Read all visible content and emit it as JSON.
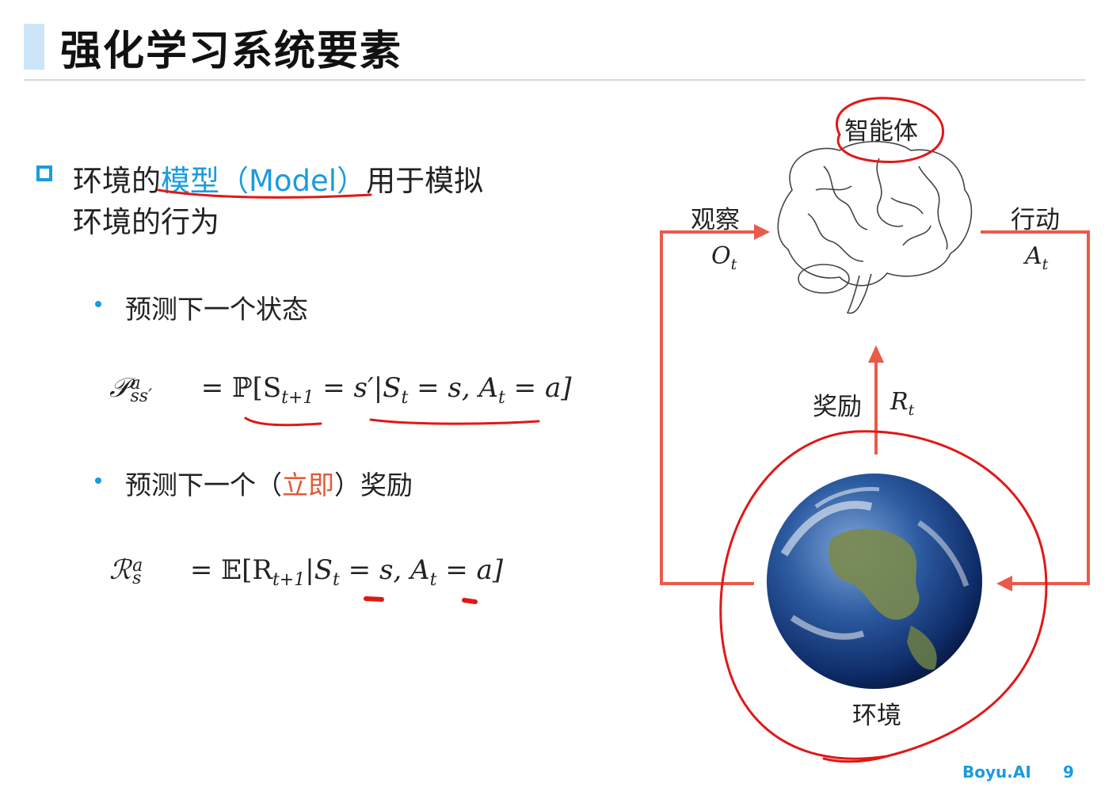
{
  "title": "强化学习系统要素",
  "main": {
    "line1_prefix": "环境的",
    "line1_highlight": "模型（Model）",
    "line1_suffix": "用于模拟",
    "line2": "环境的行为"
  },
  "subs": [
    {
      "text": "预测下一个状态"
    },
    {
      "prefix": "预测下一个（",
      "highlight": "立即",
      "suffix": "）奖励"
    }
  ],
  "formulas": {
    "transition": {
      "lhs_symbol": "𝒫",
      "lhs_sup": "a",
      "lhs_sub": "ss′",
      "rhs": "= ℙ[S",
      "rhs_sub1": "t+1",
      "rhs_mid": " = s′|S",
      "rhs_sub2": "t",
      "rhs_mid2": " = s, A",
      "rhs_sub3": "t",
      "rhs_end": " = a]"
    },
    "reward": {
      "lhs_symbol": "ℛ",
      "lhs_sup": "a",
      "lhs_sub": "s",
      "rhs": "= 𝔼[R",
      "rhs_sub1": "t+1",
      "rhs_mid": "|S",
      "rhs_sub2": "t",
      "rhs_mid2": " = s, A",
      "rhs_sub3": "t",
      "rhs_end": " = a]"
    }
  },
  "diagram": {
    "agent_label": "智能体",
    "observe_label": "观察",
    "observe_symbol": "O",
    "observe_sub": "t",
    "action_label": "行动",
    "action_symbol": "A",
    "action_sub": "t",
    "reward_label": "奖励",
    "reward_symbol": "R",
    "reward_sub": "t",
    "env_label": "环境"
  },
  "footer": {
    "brand": "Boyu.AI",
    "page": "9"
  },
  "colors": {
    "accent_blue": "#1a9be0",
    "arrow_red": "#ea5a4a",
    "annotation_red": "#e01818",
    "highlight_orange": "#e05a3a"
  }
}
